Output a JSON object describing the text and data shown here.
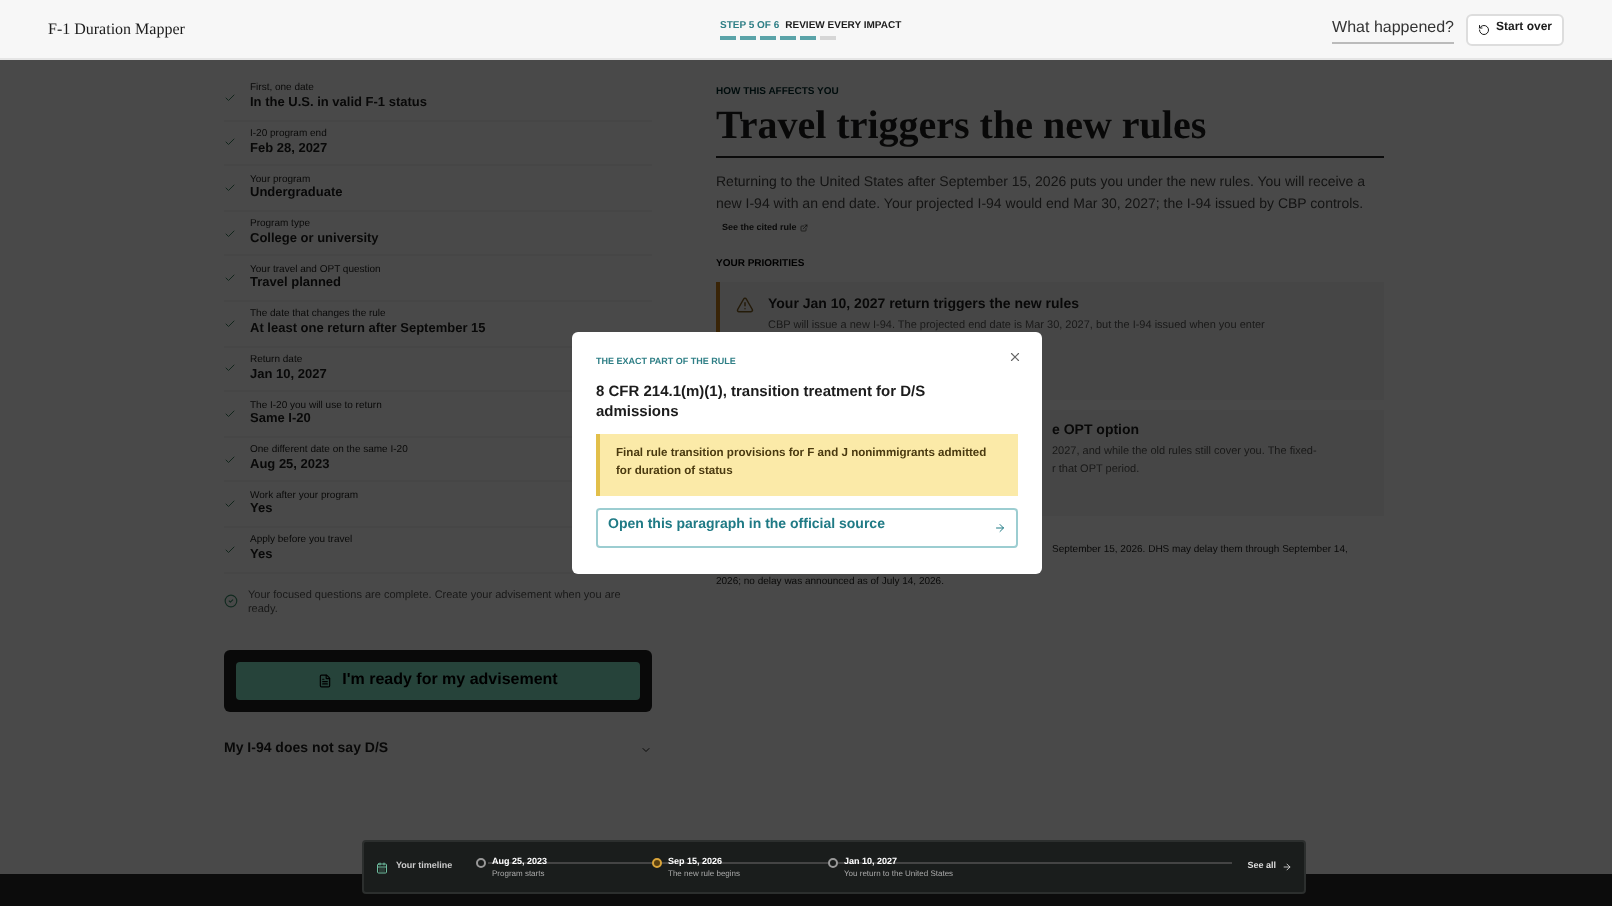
{
  "header": {
    "logo": "F-1 Duration Mapper",
    "step": "STEP 5 OF 6",
    "step_title": "REVIEW EVERY IMPACT",
    "segments": [
      {
        "done": true
      },
      {
        "done": true
      },
      {
        "done": true
      },
      {
        "done": true
      },
      {
        "done": true
      },
      {
        "done": false
      }
    ],
    "what_happened": "What happened?",
    "start_over": "Start over"
  },
  "answers": [
    {
      "label": "First, one date",
      "value": "In the U.S. in valid F-1 status"
    },
    {
      "label": "I-20 program end",
      "value": "Feb 28, 2027"
    },
    {
      "label": "Your program",
      "value": "Undergraduate"
    },
    {
      "label": "Program type",
      "value": "College or university"
    },
    {
      "label": "Your travel and OPT question",
      "value": "Travel planned"
    },
    {
      "label": "The date that changes the rule",
      "value": "At least one return after September 15"
    },
    {
      "label": "Return date",
      "value": "Jan 10, 2027"
    },
    {
      "label": "The I-20 you will use to return",
      "value": "Same I-20"
    },
    {
      "label": "One different date on the same I-20",
      "value": "Aug 25, 2023"
    },
    {
      "label": "Work after your program",
      "value": "Yes"
    },
    {
      "label": "Apply before you travel",
      "value": "Yes"
    }
  ],
  "complete_note": "Your focused questions are complete. Create your advisement when you are ready.",
  "ready_button": "I'm ready for my advisement",
  "accordion": {
    "title": "My I-94 does not say D/S",
    "expanded": false
  },
  "main": {
    "eyebrow": "HOW THIS AFFECTS YOU",
    "title": "Travel triggers the new rules",
    "body": "Returning to the United States after September 15, 2026 puts you under the new rules. You will receive a new I-94 with an end date. Your projected I-94 would end Mar 30, 2027; the I-94 issued by CBP controls.",
    "link": "See the cited rule",
    "priorities_heading": "YOUR PRIORITIES",
    "priorities": [
      {
        "kind": "warning",
        "title": "Your Jan 10, 2027 return triggers the new rules",
        "lines": [
          "CBP will issue a new I-94. The projected end date is Mar 30, 2027, but the I-94 issued when you enter"
        ]
      },
      {
        "kind": "partial",
        "title": "e OPT option",
        "lines": [
          "2027, and while the old rules still cover you. The fixed-",
          "r that OPT period."
        ]
      }
    ],
    "footnote": [
      "September 15, 2026. DHS may delay them through September 14,",
      "2026; no delay was announced as of July 14, 2026."
    ]
  },
  "dialog": {
    "eyebrow": "THE EXACT PART OF THE RULE",
    "title": "8 CFR 214.1(m)(1), transition treatment for D/S admissions",
    "quote": "Final rule transition provisions for F and J nonimmigrants admitted for duration of status",
    "link": "Open this paragraph in the official source"
  },
  "timeline": {
    "title": "Your timeline",
    "events": [
      {
        "date": "Aug 25, 2023",
        "caption": "Program starts",
        "current": false
      },
      {
        "date": "Sep 15, 2026",
        "caption": "The new rule begins",
        "current": true
      },
      {
        "date": "Jan 10, 2027",
        "caption": "You return to the United States",
        "current": false
      }
    ],
    "see_all": "See all"
  }
}
